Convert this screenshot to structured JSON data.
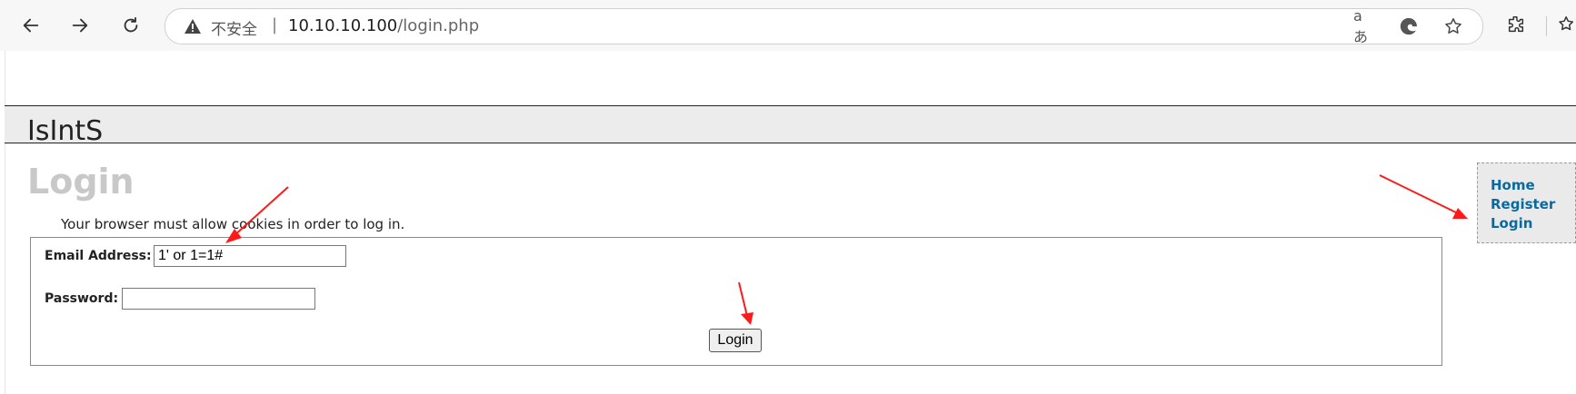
{
  "browser": {
    "address": {
      "insecure_label": "不安全",
      "separator": "|",
      "url_host": "10.10.10.100",
      "url_path": "/login.php"
    },
    "icons": {
      "back": "back-arrow-icon",
      "forward": "forward-arrow-icon",
      "reload": "reload-icon",
      "warning": "warning-icon",
      "read_aloud": "read-aloud-icon",
      "edge": "edge-icon",
      "favorite": "star-icon",
      "extensions": "extensions-icon",
      "favorites_bar": "favorites-icon"
    },
    "read_aloud_label": "aあ"
  },
  "site": {
    "title": "IsIntS"
  },
  "login_page": {
    "heading": "Login",
    "cookie_note": "Your browser must allow cookies in order to log in.",
    "email_label": "Email Address:",
    "email_value": "1' or 1=1#",
    "password_label": "Password:",
    "password_value": "",
    "submit_label": "Login"
  },
  "side_nav": {
    "items": [
      {
        "label": "Home"
      },
      {
        "label": "Register"
      },
      {
        "label": "Login"
      }
    ]
  },
  "colors": {
    "annotation_arrow": "#ff1a1a",
    "link": "#0a6aa0",
    "heading": "#c8c8c8",
    "header_band": "#ececec"
  }
}
